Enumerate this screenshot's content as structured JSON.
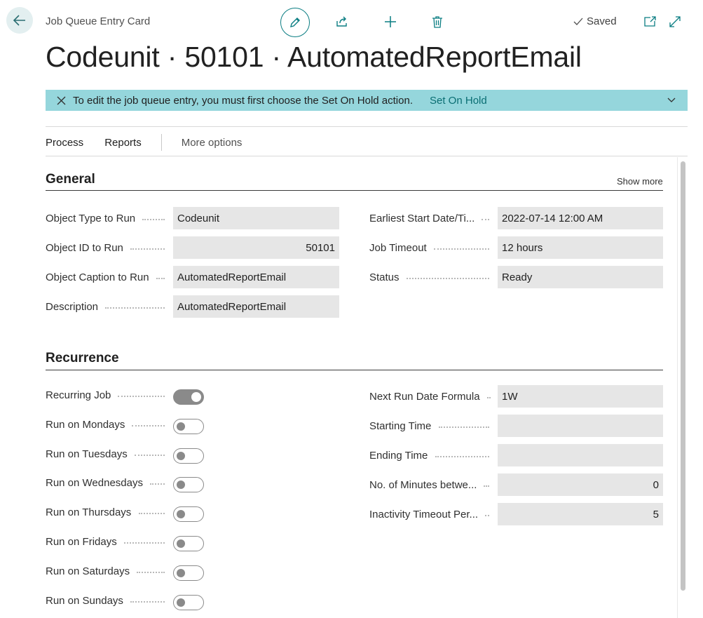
{
  "header": {
    "breadcrumb": "Job Queue Entry Card",
    "saved_label": "Saved",
    "title": "Codeunit · 50101 · AutomatedReportEmail"
  },
  "banner": {
    "message": "To edit the job queue entry, you must first choose the Set On Hold action.",
    "action": "Set On Hold"
  },
  "actions": {
    "process": "Process",
    "reports": "Reports",
    "more": "More options"
  },
  "general": {
    "title": "General",
    "show_more": "Show more",
    "left": [
      {
        "label": "Object Type to Run",
        "value": "Codeunit",
        "numeric": false
      },
      {
        "label": "Object ID to Run",
        "value": "50101",
        "numeric": true
      },
      {
        "label": "Object Caption to Run",
        "value": "AutomatedReportEmail",
        "numeric": false
      },
      {
        "label": "Description",
        "value": "AutomatedReportEmail",
        "numeric": false
      }
    ],
    "right": [
      {
        "label": "Earliest Start Date/Ti...",
        "value": "2022-07-14 12:00 AM",
        "numeric": false
      },
      {
        "label": "Job Timeout",
        "value": "12 hours",
        "numeric": false
      },
      {
        "label": "Status",
        "value": "Ready",
        "numeric": false
      }
    ]
  },
  "recurrence": {
    "title": "Recurrence",
    "toggles": [
      {
        "label": "Recurring Job",
        "on": true
      },
      {
        "label": "Run on Mondays",
        "on": false
      },
      {
        "label": "Run on Tuesdays",
        "on": false
      },
      {
        "label": "Run on Wednesdays",
        "on": false
      },
      {
        "label": "Run on Thursdays",
        "on": false
      },
      {
        "label": "Run on Fridays",
        "on": false
      },
      {
        "label": "Run on Saturdays",
        "on": false
      },
      {
        "label": "Run on Sundays",
        "on": false
      }
    ],
    "right": [
      {
        "label": "Next Run Date Formula",
        "value": "1W",
        "numeric": false
      },
      {
        "label": "Starting Time",
        "value": "",
        "numeric": false
      },
      {
        "label": "Ending Time",
        "value": "",
        "numeric": false
      },
      {
        "label": "No. of Minutes betwe...",
        "value": "0",
        "numeric": true
      },
      {
        "label": "Inactivity Timeout Per...",
        "value": "5",
        "numeric": true
      }
    ]
  },
  "colors": {
    "accent": "#0a7d82",
    "banner_bg": "#95d6dc",
    "field_bg": "#e6e6e6"
  },
  "icons": [
    "back-arrow-icon",
    "edit-pencil-icon",
    "share-icon",
    "add-icon",
    "delete-icon",
    "checkmark-icon",
    "open-new-window-icon",
    "expand-icon",
    "close-icon",
    "chevron-down-icon"
  ]
}
